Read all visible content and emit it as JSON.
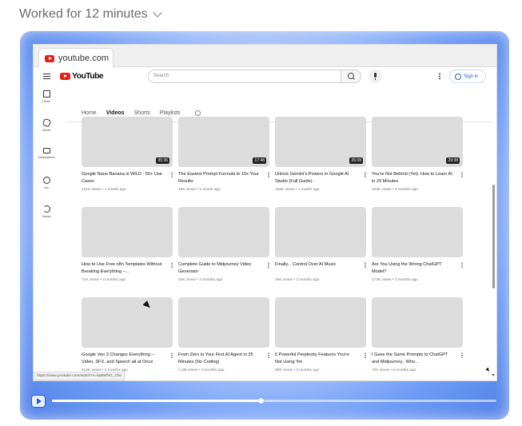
{
  "status": {
    "text": "Worked for 12 minutes"
  },
  "browser": {
    "tab_title": "youtube.com",
    "status_url": "https://www.youtube.com/watch?v=9yBMfvG_Cfw"
  },
  "youtube": {
    "logo_text": "YouTube",
    "search_placeholder": "Search",
    "signin_label": "Sign in",
    "sidebar": [
      {
        "label": "Home",
        "icon": "home-icon"
      },
      {
        "label": "Shorts",
        "icon": "shorts-icon"
      },
      {
        "label": "Subscriptions",
        "icon": "subscriptions-icon"
      },
      {
        "label": "You",
        "icon": "you-icon"
      },
      {
        "label": "History",
        "icon": "history-icon"
      }
    ],
    "tabs": [
      "Home",
      "Videos",
      "Shorts",
      "Playlists"
    ],
    "active_tab": "Videos",
    "videos": [
      {
        "title": "Google Nano Banana is WILD - 50+ Use Cases",
        "meta": "441K views • 1 month ago",
        "duration": "35:36"
      },
      {
        "title": "The Easiest Prompt Formula to 10x Your Results",
        "meta": "45K views • 1 month ago",
        "duration": "17:48"
      },
      {
        "title": "Unlock Gemini's Powers in Google AI Studio (Full Guide)",
        "meta": "166K views • 1 month ago",
        "duration": "26:08"
      },
      {
        "title": "You're Not Behind (Yet): How to Learn AI in 29 Minutes",
        "meta": "423K views • 2 months ago",
        "duration": "29:38"
      },
      {
        "title": "How to Use Free n8n Templates Without Breaking Everything –...",
        "meta": "71K views • 3 months ago",
        "duration": ""
      },
      {
        "title": "Complete Guide to Midjourney Video Generator",
        "meta": "83K views • 3 months ago",
        "duration": ""
      },
      {
        "title": "Finally... Control Over AI Music",
        "meta": "16K views • 3 months ago",
        "duration": ""
      },
      {
        "title": "Are You Using the Wrong ChatGPT Model?",
        "meta": "173K views • 3 months ago",
        "duration": ""
      },
      {
        "title": "Google Veo 3 Changes Everything – Video, SFX, and Speech all at Once",
        "meta": "512K views • 4 months ago",
        "duration": ""
      },
      {
        "title": "From Zero to Your First AI Agent in 25 Minutes (No Coding)",
        "meta": "2.3M views • 4 months ago",
        "duration": ""
      },
      {
        "title": "5 Powerful Perplexity Features You're Not Using Yet",
        "meta": "98K views • 3 months ago",
        "duration": ""
      },
      {
        "title": "I Gave the Same Prompts to ChatGPT and Midjourney.. Who...",
        "meta": "72K views • 5 months ago",
        "duration": ""
      }
    ]
  },
  "playback": {
    "progress_fraction": 0.47
  },
  "colors": {
    "accent": "#1d5fd8",
    "youtube_red": "#e62117"
  }
}
